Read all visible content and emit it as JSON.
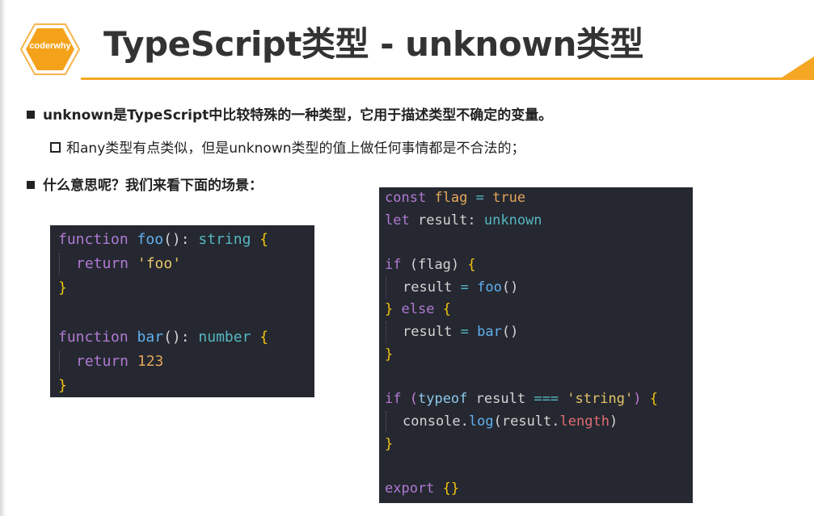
{
  "header": {
    "logo_text": "coderwhy",
    "title": "TypeScript类型 - unknown类型"
  },
  "bullets": {
    "b1": "unknown是TypeScript中比较特殊的一种类型，它用于描述类型不确定的变量。",
    "b2": "和any类型有点类似，但是unknown类型的值上做任何事情都是不合法的；",
    "b3": "什么意思呢？我们来看下面的场景："
  },
  "code_left": {
    "l1": [
      "function",
      "foo",
      "():",
      "string",
      "{"
    ],
    "l2": [
      "return",
      "'foo'"
    ],
    "l3": [
      "}"
    ],
    "l5": [
      "function",
      "bar",
      "():",
      "number",
      "{"
    ],
    "l6": [
      "return",
      "123"
    ],
    "l7": [
      "}"
    ]
  },
  "code_right": {
    "l1": [
      "const",
      "flag",
      "=",
      "true"
    ],
    "l2": [
      "let",
      "result:",
      "unknown"
    ],
    "l4": [
      "if",
      "(flag)",
      "{"
    ],
    "l5": [
      "result",
      "=",
      "foo",
      "()"
    ],
    "l6": [
      "}",
      "else",
      "{"
    ],
    "l7": [
      "result",
      "=",
      "bar",
      "()"
    ],
    "l8": [
      "}"
    ],
    "l10": [
      "if",
      "(",
      "typeof",
      "result",
      "===",
      "'string'",
      ")",
      "{"
    ],
    "l11": [
      "console",
      ".",
      "log",
      "(result.",
      "length",
      ")"
    ],
    "l12": [
      "}"
    ],
    "l14": [
      "export",
      "{}"
    ]
  },
  "colors": {
    "accent": "#f5a623",
    "code_bg": "#252830",
    "keyword": "#b079d4",
    "type": "#56b6c2",
    "function": "#61afef",
    "string": "#e8c46a",
    "number": "#e3a35c",
    "brace": "#f2c40f"
  }
}
